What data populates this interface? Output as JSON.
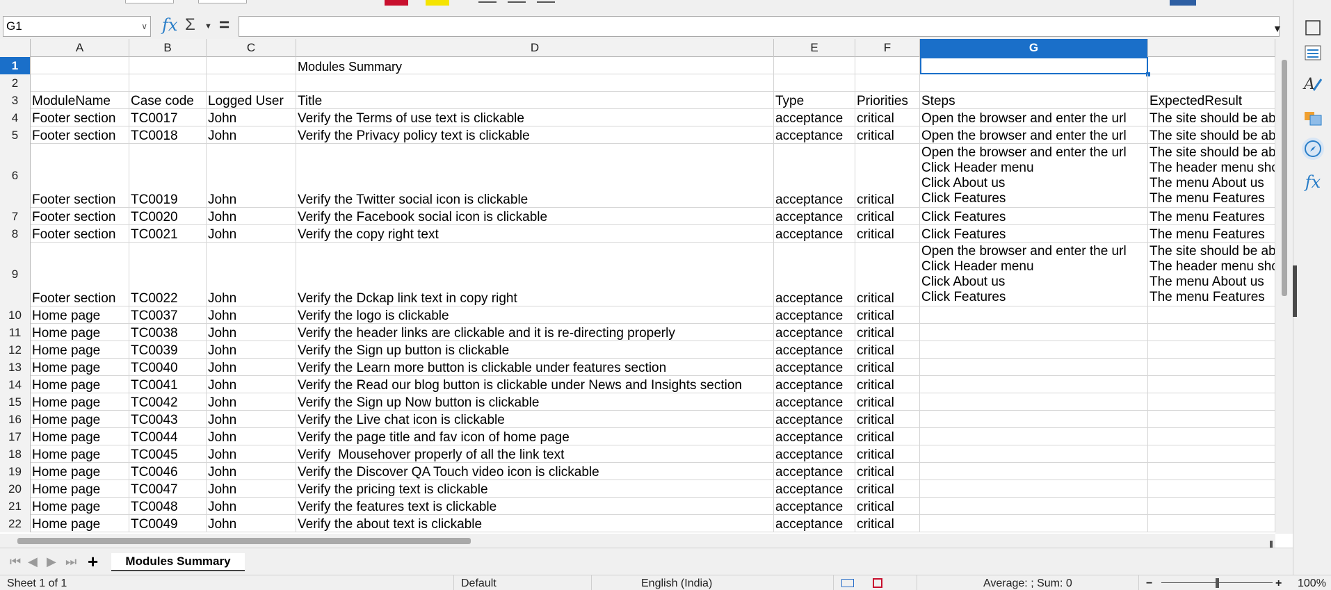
{
  "name_box": "G1",
  "formula_value": "",
  "columns": [
    {
      "id": "A",
      "label": "A"
    },
    {
      "id": "B",
      "label": "B"
    },
    {
      "id": "C",
      "label": "C"
    },
    {
      "id": "D",
      "label": "D"
    },
    {
      "id": "E",
      "label": "E"
    },
    {
      "id": "F",
      "label": "F"
    },
    {
      "id": "G",
      "label": "G",
      "selected": true
    },
    {
      "id": "H",
      "label": ""
    }
  ],
  "rows": [
    {
      "num": "1",
      "selected": true,
      "cells": [
        "",
        "",
        "",
        "Modules Summary",
        "",
        "",
        "",
        ""
      ]
    },
    {
      "num": "2",
      "cells": [
        "",
        "",
        "",
        "",
        "",
        "",
        "",
        ""
      ]
    },
    {
      "num": "3",
      "cells": [
        "ModuleName",
        "Case code",
        "Logged User",
        "Title",
        "Type",
        "Priorities",
        "Steps",
        "ExpectedResult"
      ]
    },
    {
      "num": "4",
      "cells": [
        "Footer section",
        "TC0017",
        "John",
        "Verify the Terms of use text is clickable",
        "acceptance",
        "critical",
        "Open the browser and enter the url",
        "The site should be able to open"
      ]
    },
    {
      "num": "5",
      "cells": [
        "Footer section",
        "TC0018",
        "John",
        "Verify the Privacy policy text is clickable",
        "acceptance",
        "critical",
        "Open the browser and enter the url",
        "The site should be able to open"
      ]
    },
    {
      "num": "6",
      "tall": true,
      "cells": [
        "Footer section",
        "TC0019",
        "John",
        "Verify the Twitter social icon is clickable",
        "acceptance",
        "critical",
        "Open the browser and enter the url\nClick Header menu\nClick About us\nClick Features",
        "The site should be able to open\nThe header menu should display\nThe menu About us\nThe menu Features"
      ]
    },
    {
      "num": "7",
      "cells": [
        "Footer section",
        "TC0020",
        "John",
        "Verify the Facebook social icon is clickable",
        "acceptance",
        "critical",
        "Click Features",
        "The menu Features"
      ]
    },
    {
      "num": "8",
      "cells": [
        "Footer section",
        "TC0021",
        "John",
        "Verify the copy right text",
        "acceptance",
        "critical",
        "Click Features",
        "The menu Features"
      ]
    },
    {
      "num": "9",
      "tall": true,
      "cells": [
        "Footer section",
        "TC0022",
        "John",
        "Verify the Dckap link text in copy right",
        "acceptance",
        "critical",
        "Open the browser and enter the url\nClick Header menu\nClick About us\nClick Features",
        "The site should be able to open\nThe header menu should display\nThe menu About us\nThe menu Features"
      ]
    },
    {
      "num": "10",
      "cells": [
        "Home page",
        "TC0037",
        "John",
        "Verify the logo is clickable",
        "acceptance",
        "critical",
        "",
        ""
      ]
    },
    {
      "num": "11",
      "cells": [
        "Home page",
        "TC0038",
        "John",
        "Verify the header links are clickable and it is re-directing properly",
        "acceptance",
        "critical",
        "",
        ""
      ]
    },
    {
      "num": "12",
      "cells": [
        "Home page",
        "TC0039",
        "John",
        "Verify the Sign up button is clickable",
        "acceptance",
        "critical",
        "",
        ""
      ]
    },
    {
      "num": "13",
      "cells": [
        "Home page",
        "TC0040",
        "John",
        "Verify the Learn more button is clickable under features section",
        "acceptance",
        "critical",
        "",
        ""
      ]
    },
    {
      "num": "14",
      "cells": [
        "Home page",
        "TC0041",
        "John",
        "Verify the Read our blog button is clickable under News and Insights section",
        "acceptance",
        "critical",
        "",
        ""
      ]
    },
    {
      "num": "15",
      "cells": [
        "Home page",
        "TC0042",
        "John",
        "Verify the Sign up Now button is clickable",
        "acceptance",
        "critical",
        "",
        ""
      ]
    },
    {
      "num": "16",
      "cells": [
        "Home page",
        "TC0043",
        "John",
        "Verify the Live chat icon is clickable",
        "acceptance",
        "critical",
        "",
        ""
      ]
    },
    {
      "num": "17",
      "cells": [
        "Home page",
        "TC0044",
        "John",
        "Verify the page title and fav icon of home page",
        "acceptance",
        "critical",
        "",
        ""
      ]
    },
    {
      "num": "18",
      "cells": [
        "Home page",
        "TC0045",
        "John",
        "Verify  Mousehover properly of all the link text",
        "acceptance",
        "critical",
        "",
        ""
      ]
    },
    {
      "num": "19",
      "cells": [
        "Home page",
        "TC0046",
        "John",
        "Verify the Discover QA Touch video icon is clickable",
        "acceptance",
        "critical",
        "",
        ""
      ]
    },
    {
      "num": "20",
      "cells": [
        "Home page",
        "TC0047",
        "John",
        "Verify the pricing text is clickable",
        "acceptance",
        "critical",
        "",
        ""
      ]
    },
    {
      "num": "21",
      "cells": [
        "Home page",
        "TC0048",
        "John",
        "Verify the features text is clickable",
        "acceptance",
        "critical",
        "",
        ""
      ]
    },
    {
      "num": "22",
      "cells": [
        "Home page",
        "TC0049",
        "John",
        "Verify the about text is clickable",
        "acceptance",
        "critical",
        "",
        ""
      ]
    }
  ],
  "sheet_tab": {
    "label": "Modules Summary"
  },
  "status": {
    "sheet": "Sheet 1 of 1",
    "page_style": "Default",
    "language": "English (India)",
    "selection_stats": "Average: ; Sum: 0",
    "zoom": "100%"
  },
  "colors": {
    "accent": "#1a6fc9"
  },
  "sidebar_icons": [
    "properties-icon",
    "styles-icon",
    "gallery-icon",
    "navigator-icon",
    "functions-icon"
  ]
}
